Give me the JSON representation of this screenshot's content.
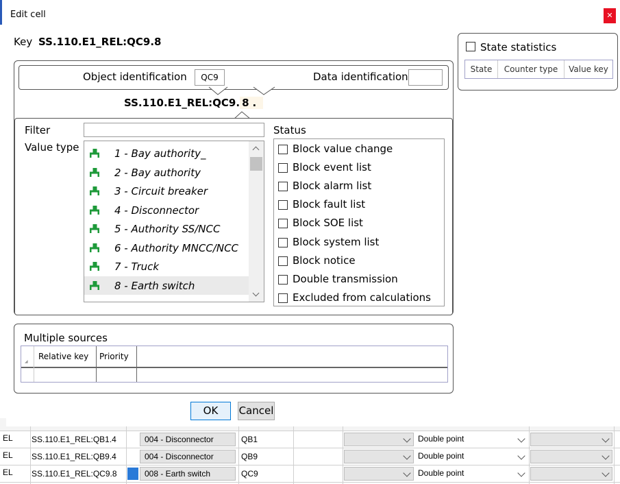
{
  "dialog": {
    "title": "Edit cell",
    "key_label": "Key",
    "key_value": "SS.110.E1_REL:QC9.8",
    "ok_label": "OK",
    "cancel_label": "Cancel"
  },
  "identification": {
    "object_label": "Object identification",
    "object_value": "QC9",
    "data_label": "Data identification",
    "data_value": "",
    "preview_prefix": "SS.110.E1_REL:QC9.",
    "preview_index": "8",
    "preview_suffix": "."
  },
  "filter": {
    "label": "Filter",
    "value": ""
  },
  "value_type": {
    "label": "Value type",
    "items": [
      "1 - Bay authority_",
      "2 - Bay authority",
      "3 - Circuit breaker",
      "4 - Disconnector",
      "5 - Authority SS/NCC",
      "6 - Authority MNCC/NCC",
      "7 - Truck",
      "8 - Earth switch"
    ],
    "selected_index": 7
  },
  "status": {
    "label": "Status",
    "items": [
      {
        "label": "Block value change",
        "checked": false
      },
      {
        "label": "Block event list",
        "checked": false
      },
      {
        "label": "Block alarm list",
        "checked": false
      },
      {
        "label": "Block fault list",
        "checked": false
      },
      {
        "label": "Block SOE list",
        "checked": false
      },
      {
        "label": "Block system list",
        "checked": false
      },
      {
        "label": "Block notice",
        "checked": false
      },
      {
        "label": "Double transmission",
        "checked": false
      },
      {
        "label": "Excluded from calculations",
        "checked": false
      }
    ]
  },
  "multiple_sources": {
    "label": "Multiple sources",
    "columns": [
      "Relative key",
      "Priority"
    ]
  },
  "state_statistics": {
    "label": "State statistics",
    "checked": false,
    "columns": [
      "State",
      "Counter type",
      "Value key"
    ]
  },
  "background_rows": [
    {
      "prefix": "EL",
      "key": "SS.110.E1_REL:QB1.4",
      "type": "004 - Disconnector",
      "obj": "QB1",
      "signal": "Double point"
    },
    {
      "prefix": "EL",
      "key": "SS.110.E1_REL:QB9.4",
      "type": "004 - Disconnector",
      "obj": "QB9",
      "signal": "Double point"
    },
    {
      "prefix": "EL",
      "key": "SS.110.E1_REL:QC9.8",
      "type": "008 - Earth switch",
      "obj": "QC9",
      "signal": "Double point"
    }
  ],
  "colors": {
    "close_button": "#e81123",
    "accent_bar": "#2a5ab8",
    "icon_green": "#1e9a3a",
    "selected_row": "#eaeaea"
  }
}
